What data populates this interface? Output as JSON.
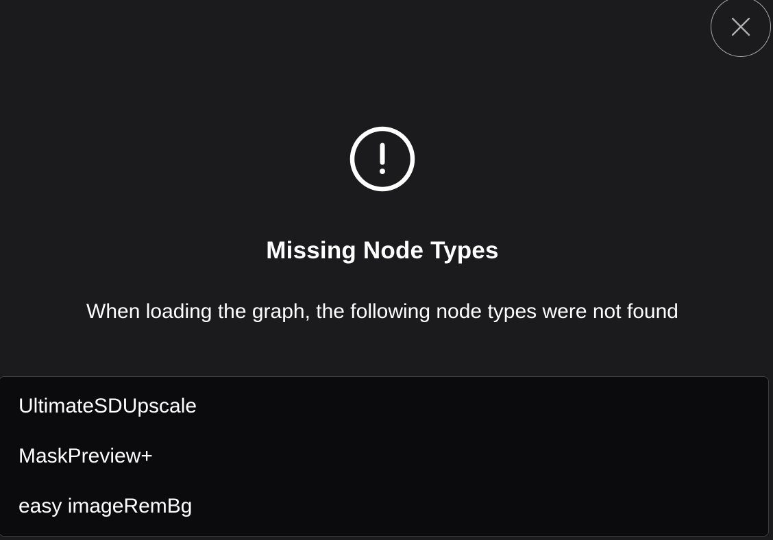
{
  "dialog": {
    "close_icon": "close-icon",
    "alert_icon": "exclamation-circle-icon",
    "title": "Missing Node Types",
    "message": "When loading the graph, the following node types were not found",
    "missing_nodes": [
      "UltimateSDUpscale",
      "MaskPreview+",
      "easy imageRemBg"
    ]
  },
  "colors": {
    "background": "#1b1b1d",
    "list_background": "#0b0b0d",
    "list_border": "#3e3e42",
    "text": "#ffffff",
    "close_border": "#a8a8ac"
  }
}
